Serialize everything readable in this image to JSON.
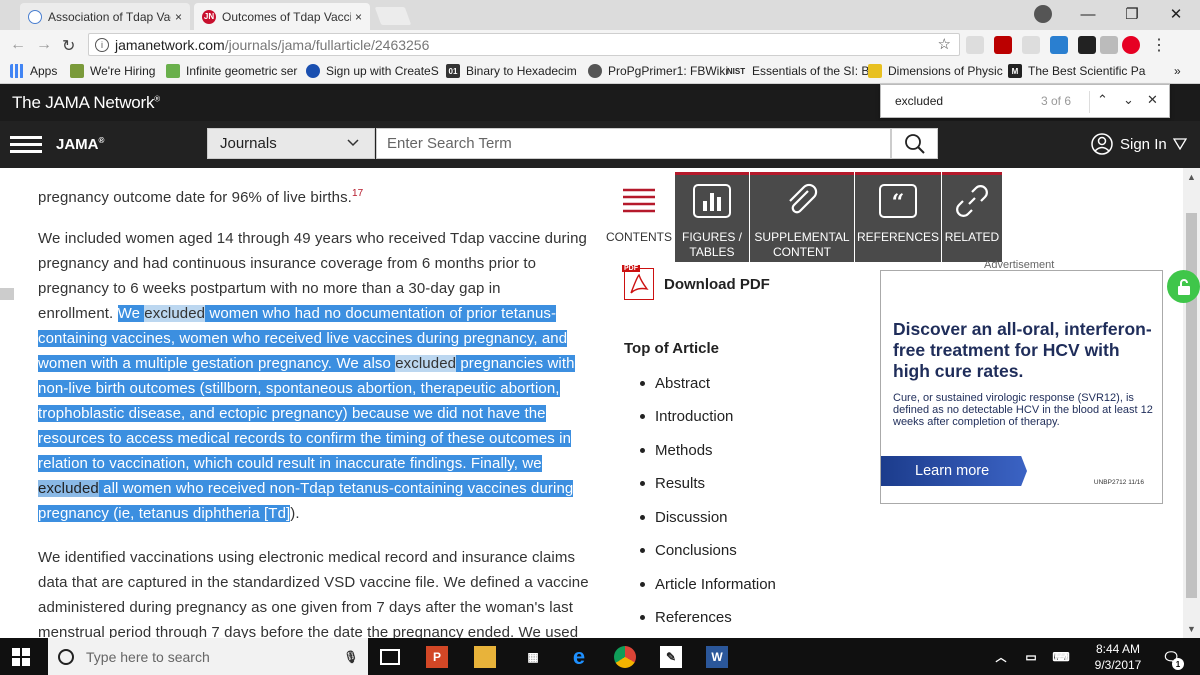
{
  "tabs": [
    {
      "title": "Association of Tdap Vacc",
      "close": "×",
      "favicon": "jama-circle-icon"
    },
    {
      "title": "Outcomes of Tdap Vaccir",
      "close": "×",
      "favicon": "jn-icon",
      "favicon_text": "JN"
    }
  ],
  "window_controls": {
    "minimize": "—",
    "restore": "❐",
    "close": "✕"
  },
  "omnibox": {
    "host": "jamanetwork.com",
    "path": "/journals/jama/fullarticle/2463256",
    "info": "i"
  },
  "bookmarks": [
    {
      "label": "Apps",
      "icon": "apps-grid-icon"
    },
    {
      "label": "We're Hiring",
      "icon": "leaf-icon"
    },
    {
      "label": "Infinite geometric ser",
      "icon": "green-leaf-icon"
    },
    {
      "label": "Sign up with CreateS",
      "icon": "createspace-icon"
    },
    {
      "label": "Binary to Hexadecim",
      "icon": "binary-icon",
      "icon_text": "01"
    },
    {
      "label": "ProPgPrimer1: FBWiki",
      "icon": "fish-icon"
    },
    {
      "label": "Essentials of the SI: B",
      "icon": "nist-icon",
      "icon_text": "NIST"
    },
    {
      "label": "Dimensions of Physic",
      "icon": "star-icon"
    },
    {
      "label": "The Best Scientific Pa",
      "icon": "medium-icon",
      "icon_text": "M"
    },
    {
      "label": "»",
      "icon": "more-icon"
    }
  ],
  "network": {
    "brand": "The JAMA Network",
    "reg": "®"
  },
  "find": {
    "query": "excluded",
    "count": "3 of 6",
    "up": "⌃",
    "down": "⌄",
    "close": "✕"
  },
  "header": {
    "logo": "JAMA",
    "logo_reg": "®",
    "journals": "Journals",
    "search_placeholder": "Enter Search Term",
    "signin": "Sign In"
  },
  "article": {
    "line0": "pregnancy outcome date for 96% of live births.",
    "ref17": "17",
    "p1": [
      "We included women aged 14 through 49 years who received Tdap vaccine during",
      "pregnancy and had continuous insurance coverage from 6 months prior to",
      "pregnancy to 6 weeks postpartum with no more than a 30-day gap in"
    ],
    "p1_l4_pre": "enrollment. ",
    "sel": {
      "l4_a": "We ",
      "l4_hit": "excluded",
      "l4_b": " women who had no documentation of prior tetanus-",
      "l5": "containing vaccines, women who received live vaccines during pregnancy, and",
      "l6_a": "women with a multiple gestation pregnancy. We also ",
      "l6_hit": "excluded",
      "l6_b": " pregnancies with",
      "l7": "non-live birth outcomes (stillborn, spontaneous abortion, therapeutic abortion,",
      "l8": "trophoblastic disease, and ectopic pregnancy) because we did not have the",
      "l9": "resources to access medical records to confirm the timing of these outcomes in",
      "l10": "relation to vaccination, which could result in inaccurate findings. Finally, we",
      "l11_hit": "excluded",
      "l11_b": " all women who received non-Tdap tetanus-containing vaccines during",
      "l12": "pregnancy (ie, tetanus diphtheria [Td]",
      "l12_end": ")."
    },
    "p2": [
      "We identified vaccinations using electronic medical record and insurance claims",
      "data that are captured in the standardized VSD vaccine file. We defined a vaccine",
      "administered during pregnancy as one given from 7 days after the woman's last",
      "menstrual period through 7 days before the date the pregnancy ended. We used"
    ]
  },
  "nav_tabs": [
    {
      "label1": "CONTENTS",
      "label2": "",
      "icon": "contents-list-icon"
    },
    {
      "label1": "FIGURES /",
      "label2": "TABLES",
      "icon": "bar-chart-icon"
    },
    {
      "label1": "SUPPLEMENTAL",
      "label2": "CONTENT",
      "icon": "paperclip-icon"
    },
    {
      "label1": "REFERENCES",
      "label2": "",
      "icon": "quote-icon"
    },
    {
      "label1": "RELATED",
      "label2": "",
      "icon": "link-icon"
    }
  ],
  "toc": {
    "download": "Download PDF",
    "pdf_tag": "PDF",
    "top": "Top of Article",
    "items": [
      "Abstract",
      "Introduction",
      "Methods",
      "Results",
      "Discussion",
      "Conclusions",
      "Article Information",
      "References"
    ]
  },
  "ad": {
    "label": "Advertisement",
    "headline": "Discover an all-oral, interferon-free treatment for HCV with high cure rates.",
    "body": "Cure, or sustained virologic response (SVR12), is defined as no detectable HCV in the blood at least 12 weeks after completion of therapy.",
    "cta": "Learn more",
    "code": "UNBP2712 11/16"
  },
  "taskbar": {
    "search": "Type here to search",
    "time": "8:44 AM",
    "date": "9/3/2017",
    "notif_count": "1"
  },
  "colors": {
    "accent": "#b5192b",
    "selection": "#3c8fe0",
    "ad_navy": "#1f2d5a",
    "lock_green": "#3fc64a"
  }
}
